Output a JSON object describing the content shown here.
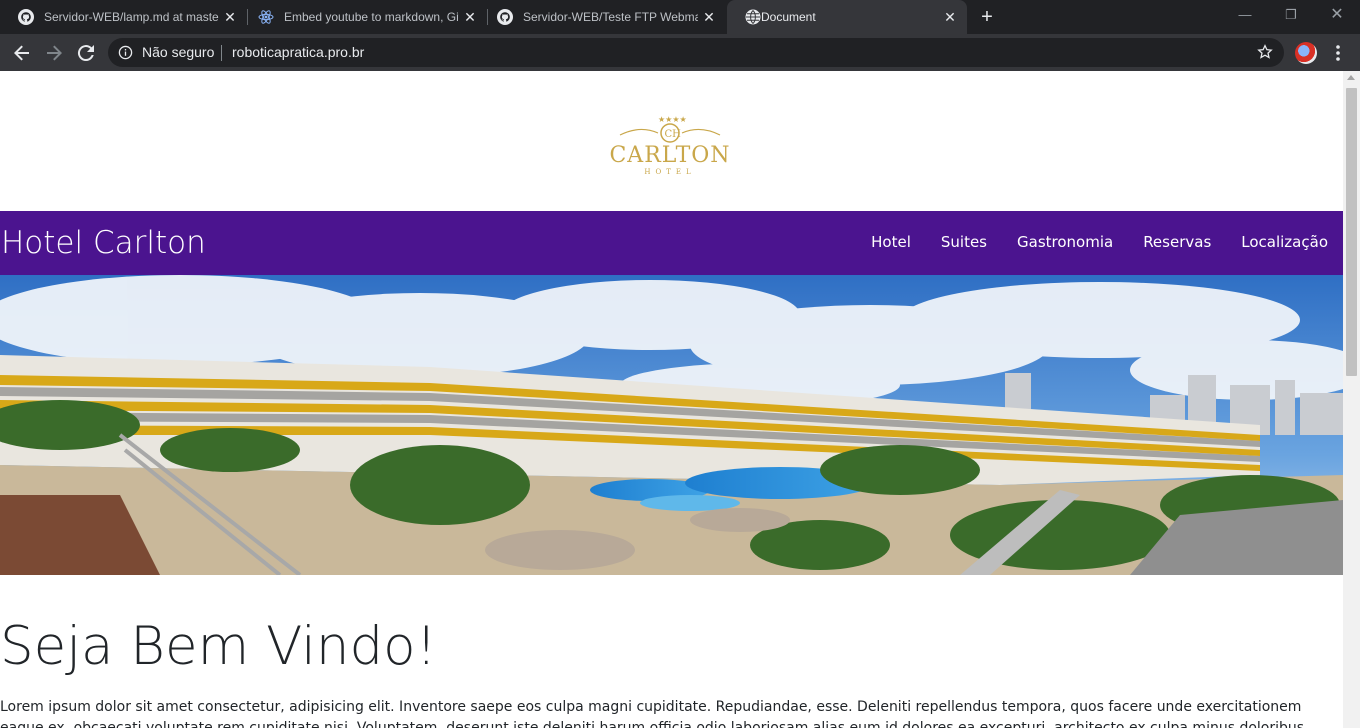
{
  "browser": {
    "tabs": [
      {
        "title": "Servidor-WEB/lamp.md at master",
        "icon": "github-icon"
      },
      {
        "title": "Embed youtube to markdown, GitHub",
        "icon": "react-icon"
      },
      {
        "title": "Servidor-WEB/Teste FTP Webmaster",
        "icon": "github-icon"
      },
      {
        "title": "Document",
        "icon": "globe-icon",
        "active": true
      }
    ],
    "security_label": "Não seguro",
    "url": "roboticapratica.pro.br"
  },
  "page": {
    "logo": {
      "word": "CARLTON",
      "sub": "HOTEL"
    },
    "brand": "Hotel Carlton",
    "nav": [
      "Hotel",
      "Suites",
      "Gastronomia",
      "Reservas",
      "Localização"
    ],
    "heading": "Seja Bem Vindo!",
    "paragraph": "Lorem ipsum dolor sit amet consectetur, adipisicing elit. Inventore saepe eos culpa magni cupiditate. Repudiandae, esse. Deleniti repellendus tempora, quos facere unde exercitationem eaque ex, obcaecati voluptate rem cupiditate nisi. Voluptatem, deserunt iste deleniti harum officia odio laboriosam alias eum id dolores ea excepturi, architecto ex culpa minus doloribus nostrum consequatur."
  },
  "colors": {
    "navbar": "#4b148f",
    "logo_gold": "#c9a74a",
    "chrome_dark": "#202124",
    "chrome_toolbar": "#35363a"
  }
}
